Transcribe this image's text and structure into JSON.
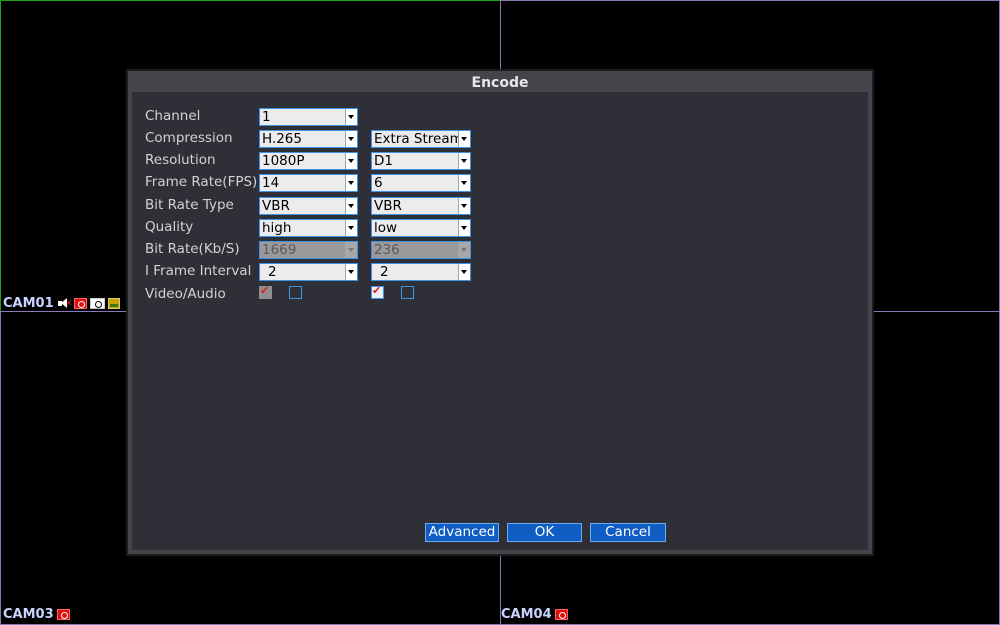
{
  "cameras": [
    {
      "id": "cam01",
      "label": "CAM01",
      "icons": [
        "mute-icon",
        "record-icon",
        "snapshot-icon",
        "hdd-icon"
      ]
    },
    {
      "id": "cam03",
      "label": "CAM03",
      "icons": [
        "record-icon"
      ]
    },
    {
      "id": "cam04",
      "label": "CAM04",
      "icons": [
        "record-icon"
      ]
    }
  ],
  "dialog": {
    "title": "Encode",
    "rows": [
      {
        "key": "channel",
        "label": "Channel",
        "main": "1",
        "extra": null
      },
      {
        "key": "compression",
        "label": "Compression",
        "main": "H.265",
        "extra": "Extra Stream"
      },
      {
        "key": "resolution",
        "label": "Resolution",
        "main": "1080P",
        "extra": "D1"
      },
      {
        "key": "frame-rate",
        "label": "Frame Rate(FPS)",
        "main": "14",
        "extra": "6"
      },
      {
        "key": "bit-rate-type",
        "label": "Bit Rate Type",
        "main": "VBR",
        "extra": "VBR"
      },
      {
        "key": "quality",
        "label": "Quality",
        "main": "high",
        "extra": "low"
      },
      {
        "key": "bit-rate",
        "label": "Bit Rate(Kb/S)",
        "main": "1669",
        "extra": "236",
        "disabled": true
      },
      {
        "key": "i-frame-interval",
        "label": "I Frame Interval",
        "main": " 2",
        "extra": " 2"
      }
    ],
    "video_audio": {
      "label": "Video/Audio",
      "main_video_checked": true,
      "main_video_disabled": true,
      "main_audio_checked": false,
      "extra_video_checked": true,
      "extra_audio_checked": false
    },
    "buttons": {
      "advanced": "Advanced",
      "ok": "OK",
      "cancel": "Cancel"
    }
  },
  "colors": {
    "accent_border": "#3d93e6",
    "button_bg": "#0f5cc2",
    "record_red": "#e01010"
  }
}
